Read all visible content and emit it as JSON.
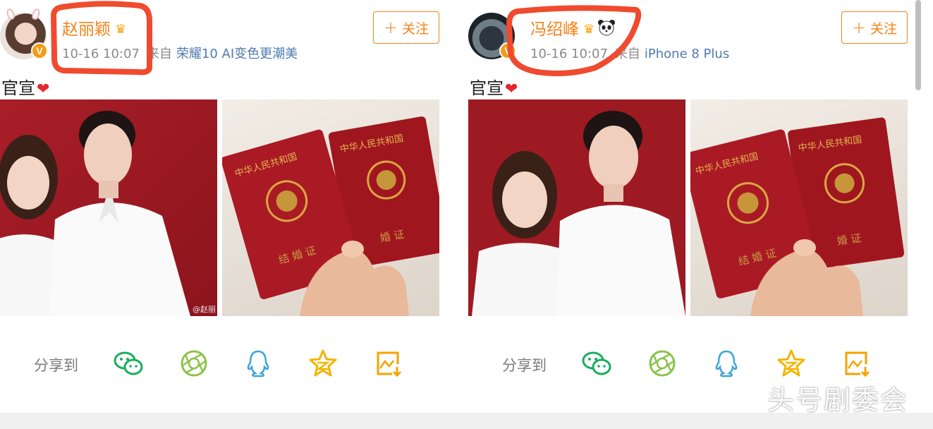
{
  "posts": [
    {
      "username": "赵丽颖",
      "time": "10-16 10:07",
      "from_label": "来自",
      "device": "荣耀10 AI变色更潮美",
      "follow_label": "关注",
      "text": "官宣",
      "verified_badge": "V",
      "image_watermark": "@赵丽",
      "share_label": "分享到"
    },
    {
      "username": "冯绍峰",
      "time": "10-16 10:07",
      "from_label": "来自",
      "device": "iPhone 8 Plus",
      "follow_label": "关注",
      "text": "官宣",
      "verified_badge": "V",
      "share_label": "分享到"
    }
  ],
  "share_icons": [
    "wechat-icon",
    "moments-icon",
    "qq-icon",
    "qzone-icon",
    "save-image-icon"
  ],
  "brand_watermark": "头号剧委会",
  "colors": {
    "accent_orange": "#f58217",
    "link_blue": "#4f7bb0",
    "wechat_green": "#1aad5e",
    "moments_green": "#8bc34a",
    "qq_blue": "#3ea4d8",
    "qzone_yellow": "#f5b400",
    "annotation_red": "#f04a2f"
  }
}
